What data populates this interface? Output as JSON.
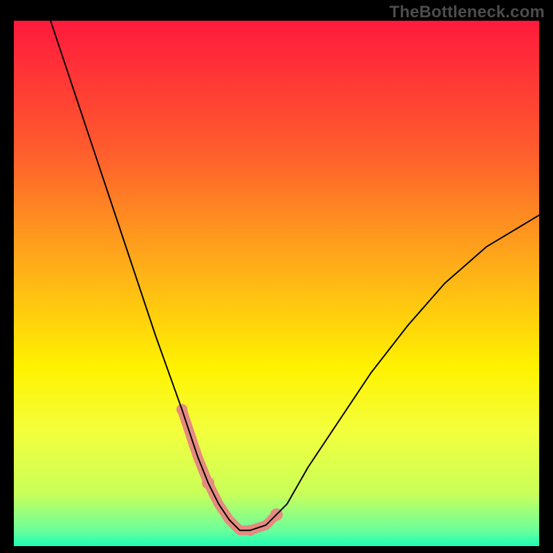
{
  "watermark": "TheBottleneck.com",
  "chart_data": {
    "type": "line",
    "title": "",
    "xlabel": "",
    "ylabel": "",
    "xlim": [
      0,
      100
    ],
    "ylim": [
      0,
      100
    ],
    "grid": false,
    "legend_position": "none",
    "background_gradient": {
      "stops": [
        {
          "offset": 0.0,
          "color": "#ff1a3c"
        },
        {
          "offset": 0.24,
          "color": "#ff5a2e"
        },
        {
          "offset": 0.48,
          "color": "#ffb217"
        },
        {
          "offset": 0.66,
          "color": "#fff200"
        },
        {
          "offset": 0.78,
          "color": "#f3ff3c"
        },
        {
          "offset": 0.9,
          "color": "#c9ff59"
        },
        {
          "offset": 0.97,
          "color": "#6cff9c"
        },
        {
          "offset": 1.0,
          "color": "#1affb4"
        }
      ]
    },
    "series": [
      {
        "name": "bottleneck-curve",
        "color": "#000000",
        "stroke_width": 2,
        "x": [
          7,
          12,
          17,
          22,
          27,
          32,
          35,
          37,
          39,
          41,
          43,
          45,
          48,
          52,
          56,
          62,
          68,
          75,
          82,
          90,
          100
        ],
        "values": [
          100,
          85,
          70,
          55,
          40,
          26,
          17,
          12,
          8,
          5,
          3,
          3,
          4,
          8,
          15,
          24,
          33,
          42,
          50,
          57,
          63
        ]
      }
    ],
    "highlight_segments": [
      {
        "name": "left-dip-marker",
        "x": [
          32,
          35,
          37
        ],
        "values": [
          26,
          17,
          12
        ],
        "color": "#e58b7f",
        "stroke_width": 14
      },
      {
        "name": "trough-marker",
        "x": [
          37,
          39,
          41,
          43,
          45,
          48
        ],
        "values": [
          12,
          8,
          5,
          3,
          3,
          4
        ],
        "color": "#e58b7f",
        "stroke_width": 14
      },
      {
        "name": "right-dip-marker",
        "x": [
          45,
          48,
          50
        ],
        "values": [
          3,
          4,
          6
        ],
        "color": "#e58b7f",
        "stroke_width": 14
      }
    ],
    "highlight_points": [
      {
        "x": 32,
        "y": 26,
        "color": "#e58b7f",
        "r": 8
      },
      {
        "x": 37,
        "y": 12,
        "color": "#e58b7f",
        "r": 9
      },
      {
        "x": 45,
        "y": 3,
        "color": "#e58b7f",
        "r": 8
      },
      {
        "x": 50,
        "y": 6,
        "color": "#e58b7f",
        "r": 9
      }
    ]
  }
}
